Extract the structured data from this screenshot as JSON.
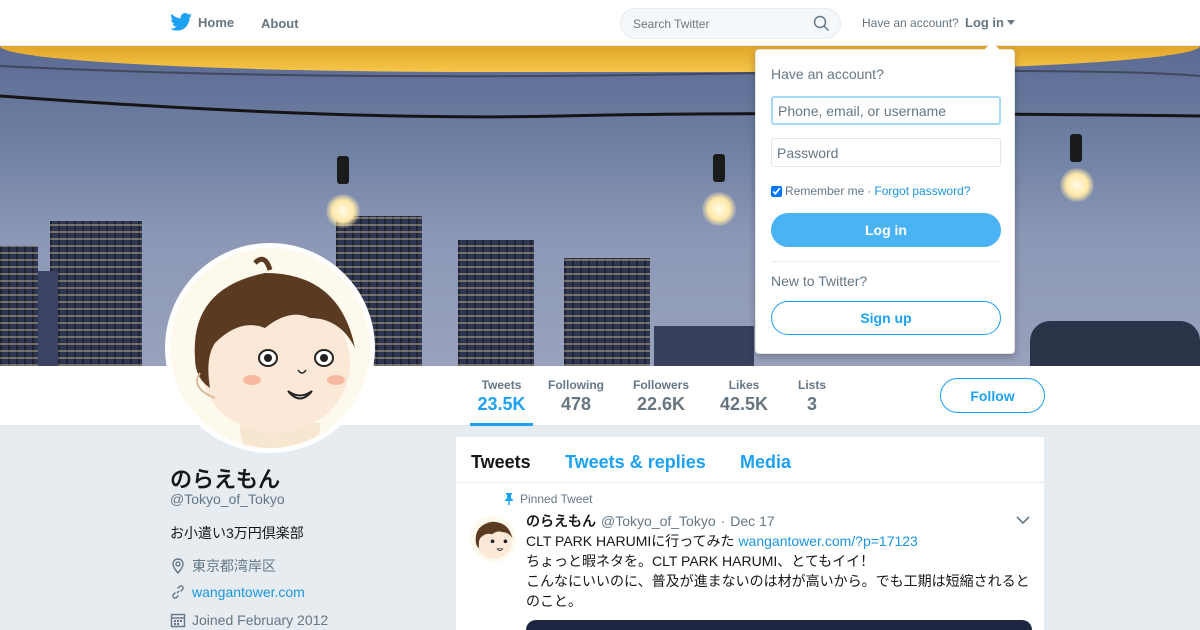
{
  "nav": {
    "home_label": "Home",
    "about_label": "About",
    "search_placeholder": "Search Twitter",
    "have_account": "Have an account?",
    "login_label": "Log in"
  },
  "profile": {
    "name": "のらえもん",
    "handle": "@Tokyo_of_Tokyo",
    "bio": "お小遣い3万円倶楽部",
    "location": "東京都湾岸区",
    "website": "wangantower.com",
    "joined": "Joined February 2012",
    "follow_label": "Follow"
  },
  "stats": [
    {
      "label": "Tweets",
      "value": "23.5K"
    },
    {
      "label": "Following",
      "value": "478"
    },
    {
      "label": "Followers",
      "value": "22.6K"
    },
    {
      "label": "Likes",
      "value": "42.5K"
    },
    {
      "label": "Lists",
      "value": "3"
    }
  ],
  "timeline": {
    "tabs": [
      "Tweets",
      "Tweets & replies",
      "Media"
    ],
    "pinned_label": "Pinned Tweet",
    "tweet": {
      "name": "のらえもん",
      "handle": "@Tokyo_of_Tokyo",
      "sep": "·",
      "date": "Dec 17",
      "line1_text": "CLT PARK HARUMIに行ってみた",
      "line1_link": "wangantower.com/?p=17123",
      "line2": "ちょっと暇ネタを。CLT PARK HARUMI、とてもイイ！",
      "line3": "こんなにいいのに、普及が進まないのは材が高いから。でも工期は短縮されるとのこと。"
    }
  },
  "login_dropdown": {
    "title": "Have an account?",
    "username_placeholder": "Phone, email, or username",
    "password_placeholder": "Password",
    "remember_label": "Remember me",
    "dot": "·",
    "forgot_label": "Forgot password?",
    "login_button": "Log in",
    "new_label": "New to Twitter?",
    "signup_button": "Sign up"
  },
  "colors": {
    "accent": "#1da1f2",
    "background": "#e6ecf0",
    "login_button": "#4ab3f4"
  },
  "icons": [
    "twitter-bird-icon",
    "search-icon",
    "caret-down-icon",
    "location-icon",
    "link-icon",
    "calendar-icon",
    "pin-icon",
    "chevron-down-icon"
  ]
}
